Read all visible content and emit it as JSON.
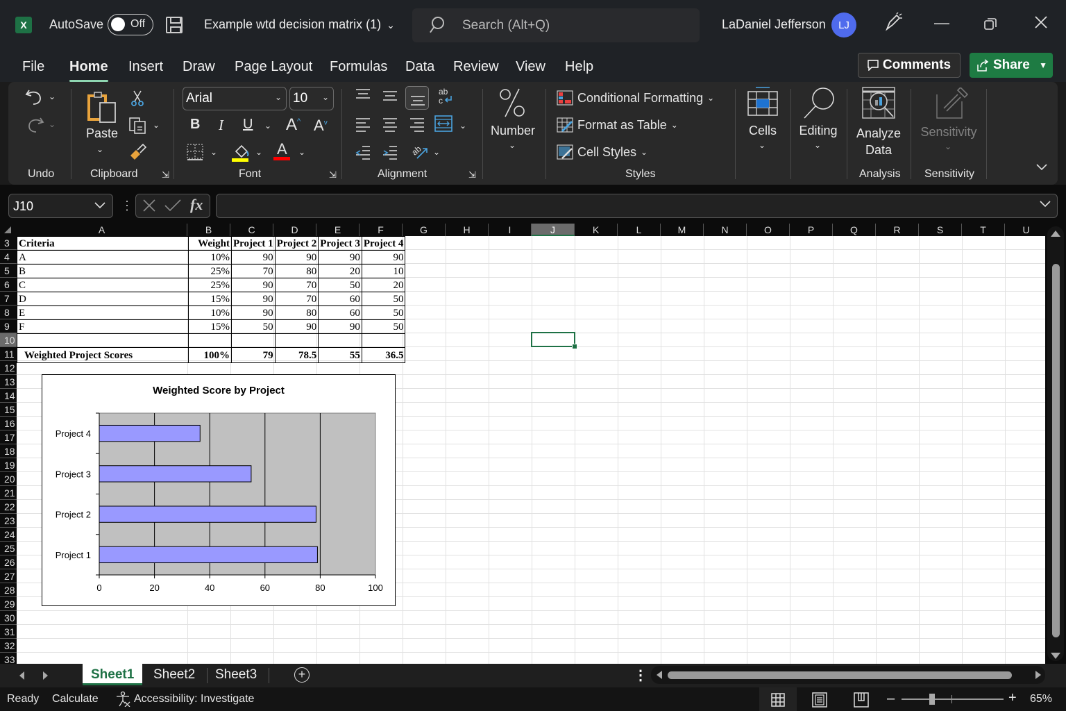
{
  "titlebar": {
    "app_icon": "excel-logo-icon",
    "app_letter": "X",
    "autosave_label": "AutoSave",
    "autosave_state": "Off",
    "doc_title": "Example wtd decision matrix (1)",
    "search_placeholder": "Search (Alt+Q)",
    "user_name": "LaDaniel Jefferson",
    "user_initials": "LJ"
  },
  "menu": {
    "items": [
      "File",
      "Home",
      "Insert",
      "Draw",
      "Page Layout",
      "Formulas",
      "Data",
      "Review",
      "View",
      "Help"
    ],
    "active": "Home",
    "comments_label": "Comments",
    "share_label": "Share"
  },
  "ribbon": {
    "groups": {
      "undo": "Undo",
      "clipboard": "Clipboard",
      "font": "Font",
      "alignment": "Alignment",
      "styles": "Styles",
      "analysis": "Analysis",
      "sensitivity": "Sensitivity"
    },
    "paste_label": "Paste",
    "font_name": "Arial",
    "font_size": "10",
    "number_label": "Number",
    "conditional_formatting": "Conditional Formatting",
    "format_as_table": "Format as Table",
    "cell_styles": "Cell Styles",
    "cells_label": "Cells",
    "editing_label": "Editing",
    "analyze_data_line1": "Analyze",
    "analyze_data_line2": "Data",
    "sensitivity_label": "Sensitivity",
    "highlight_color": "#ffff00",
    "font_color": "#ff0000"
  },
  "formula_bar": {
    "name_box": "J10",
    "fx_label": "fx",
    "formula": ""
  },
  "grid": {
    "columns": [
      "A",
      "B",
      "C",
      "D",
      "E",
      "F",
      "G",
      "H",
      "I",
      "J",
      "K",
      "L",
      "M",
      "N",
      "O",
      "P",
      "Q",
      "R",
      "S",
      "T",
      "U"
    ],
    "selected_column": "J",
    "rows": [
      "3",
      "4",
      "5",
      "6",
      "7",
      "8",
      "9",
      "10",
      "11",
      "12",
      "13",
      "14",
      "15",
      "16",
      "17",
      "18",
      "19",
      "20",
      "21",
      "22",
      "23",
      "24",
      "25",
      "26",
      "27",
      "28",
      "29",
      "30",
      "31",
      "32",
      "33"
    ],
    "selected_row": "10",
    "table": {
      "header": [
        "Criteria",
        "Weight",
        "Project 1",
        "Project 2",
        "Project 3",
        "Project 4"
      ],
      "rows": [
        [
          "A",
          "10%",
          "90",
          "90",
          "90",
          "90"
        ],
        [
          "B",
          "25%",
          "70",
          "80",
          "20",
          "10"
        ],
        [
          "C",
          "25%",
          "90",
          "70",
          "50",
          "20"
        ],
        [
          "D",
          "15%",
          "90",
          "70",
          "60",
          "50"
        ],
        [
          "E",
          "10%",
          "90",
          "80",
          "60",
          "50"
        ],
        [
          "F",
          "15%",
          "50",
          "90",
          "90",
          "50"
        ],
        [
          "",
          "",
          "",
          "",
          "",
          ""
        ]
      ],
      "total": [
        "Weighted Project Scores",
        "100%",
        "79",
        "78.5",
        "55",
        "36.5"
      ]
    }
  },
  "chart_data": {
    "type": "bar",
    "orientation": "horizontal",
    "title": "Weighted Score by Project",
    "categories": [
      "Project 1",
      "Project 2",
      "Project 3",
      "Project 4"
    ],
    "values": [
      79,
      78.5,
      55,
      36.5
    ],
    "xlabel": "",
    "ylabel": "",
    "xlim": [
      0,
      100
    ],
    "xticks": [
      0,
      20,
      40,
      60,
      80,
      100
    ],
    "grid": true,
    "legend": "none",
    "bar_color": "#9999ff",
    "plot_background": "#c0c0c0"
  },
  "sheets": {
    "tabs": [
      "Sheet1",
      "Sheet2",
      "Sheet3"
    ],
    "active": "Sheet1"
  },
  "status": {
    "ready": "Ready",
    "calculate": "Calculate",
    "accessibility": "Accessibility: Investigate",
    "zoom": "65%",
    "zoom_fraction": 0.65
  }
}
